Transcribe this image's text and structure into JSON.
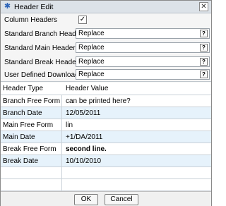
{
  "window": {
    "title": "Header Edit",
    "icon": "settings-gear-icon"
  },
  "form": {
    "column_headers": {
      "label": "Column Headers",
      "checked": true,
      "mark": "✓"
    },
    "fields": [
      {
        "label": "Standard Branch Header",
        "value": "Replace",
        "help": "?"
      },
      {
        "label": "Standard Main Header",
        "value": "Replace",
        "help": "?"
      },
      {
        "label": "Standard Break Header",
        "value": "Replace",
        "help": "?"
      },
      {
        "label": "User Defined Download",
        "value": "Replace",
        "help": "?"
      }
    ]
  },
  "table": {
    "headers": [
      "Header Type",
      "Header Value"
    ],
    "rows": [
      {
        "type": "Branch Free Form",
        "value": "can be printed here?",
        "bold": false
      },
      {
        "type": "Branch Date",
        "value": "12/05/2011",
        "bold": false
      },
      {
        "type": "Main Free Form",
        "value": "lin",
        "bold": false
      },
      {
        "type": "Main Date",
        "value": "+1/DA/2011",
        "bold": false
      },
      {
        "type": "Break Free Form",
        "value": "second line.",
        "bold": true
      },
      {
        "type": "Break Date",
        "value": "10/10/2010",
        "bold": false
      }
    ]
  },
  "footer": {
    "ok_label": "OK",
    "cancel_label": "Cancel"
  },
  "colors": {
    "row_alt": "#e6f2fb",
    "titlebar": "#dce2e8"
  }
}
